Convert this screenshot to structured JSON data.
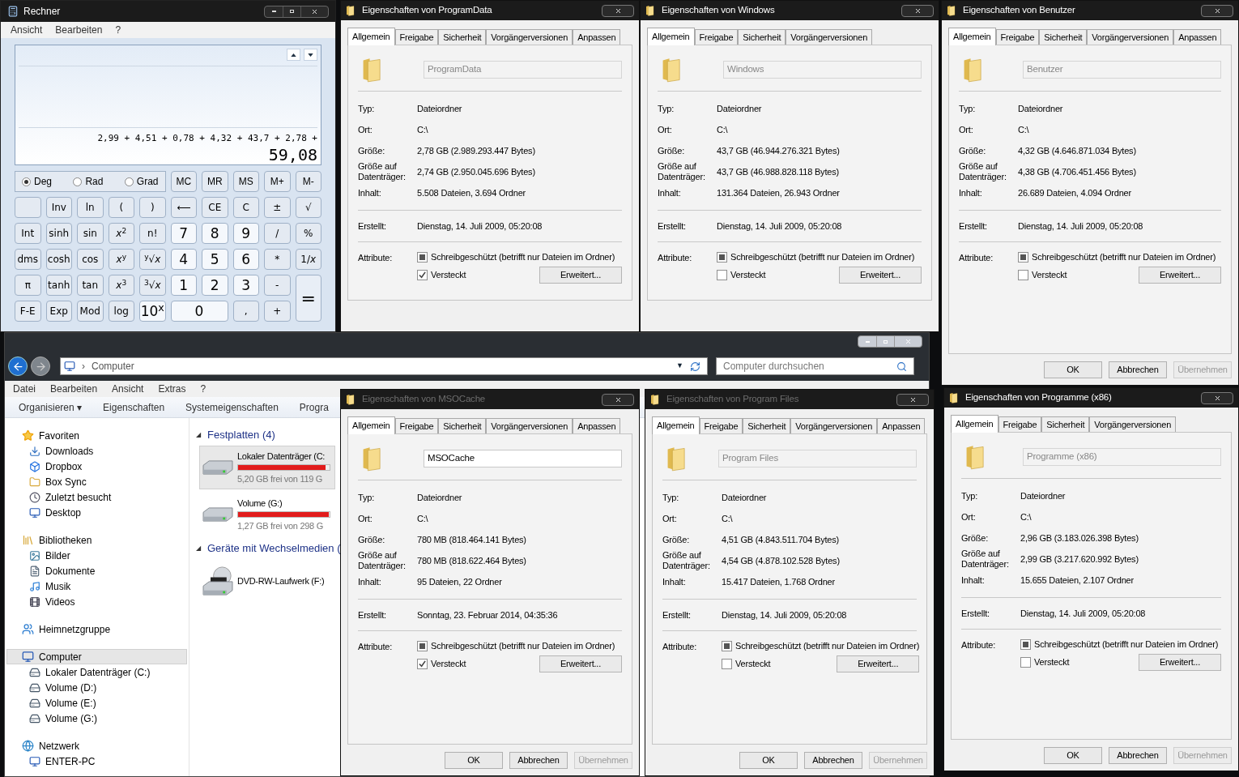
{
  "calculator": {
    "title": "Rechner",
    "menu": [
      "Ansicht",
      "Bearbeiten",
      "?"
    ],
    "expression": "2,99 + 4,51 + 0,78 + 4,32 + 43,7 + 2,78 +",
    "result": "59,08",
    "modes": [
      {
        "label": "Deg",
        "selected": true
      },
      {
        "label": "Rad",
        "selected": false
      },
      {
        "label": "Grad",
        "selected": false
      }
    ],
    "memory": [
      "MC",
      "MR",
      "MS",
      "M+",
      "M-"
    ],
    "keys": [
      {
        "kind": "blank"
      },
      {
        "kind": "func",
        "label": "Inv"
      },
      {
        "kind": "func",
        "label": "ln"
      },
      {
        "kind": "func",
        "label": "("
      },
      {
        "kind": "func",
        "label": ")"
      },
      {
        "kind": "func",
        "label": "⟵"
      },
      {
        "kind": "func",
        "label": "CE"
      },
      {
        "kind": "func",
        "label": "C"
      },
      {
        "kind": "func",
        "label": "±"
      },
      {
        "kind": "func",
        "label": "√"
      },
      {
        "kind": "func",
        "label": "Int"
      },
      {
        "kind": "func",
        "label": "sinh"
      },
      {
        "kind": "func",
        "label": "sin"
      },
      {
        "kind": "func",
        "label": "*x*$^{2}$"
      },
      {
        "kind": "func",
        "label": "n!"
      },
      {
        "kind": "digit",
        "label": "7"
      },
      {
        "kind": "digit",
        "label": "8"
      },
      {
        "kind": "digit",
        "label": "9"
      },
      {
        "kind": "func",
        "label": "/"
      },
      {
        "kind": "func",
        "label": "%"
      },
      {
        "kind": "func",
        "label": "dms"
      },
      {
        "kind": "func",
        "label": "cosh"
      },
      {
        "kind": "func",
        "label": "cos"
      },
      {
        "kind": "func",
        "label": "*x*$^{y}$"
      },
      {
        "kind": "func",
        "label": "$^{y}$√*x*"
      },
      {
        "kind": "digit",
        "label": "4"
      },
      {
        "kind": "digit",
        "label": "5"
      },
      {
        "kind": "digit",
        "label": "6"
      },
      {
        "kind": "func",
        "label": "*"
      },
      {
        "kind": "func",
        "label": "1/*x*"
      },
      {
        "kind": "func",
        "label": "π"
      },
      {
        "kind": "func",
        "label": "tanh"
      },
      {
        "kind": "func",
        "label": "tan"
      },
      {
        "kind": "func",
        "label": "*x*$^{3}$"
      },
      {
        "kind": "func",
        "label": "$^{3}$√*x*"
      },
      {
        "kind": "digit",
        "label": "1"
      },
      {
        "kind": "digit",
        "label": "2"
      },
      {
        "kind": "digit",
        "label": "3"
      },
      {
        "kind": "func",
        "label": "-"
      },
      {
        "kind": "tall",
        "label": "="
      },
      {
        "kind": "func",
        "label": "F-E"
      },
      {
        "kind": "func",
        "label": "Exp"
      },
      {
        "kind": "func",
        "label": "Mod"
      },
      {
        "kind": "func",
        "label": "log"
      },
      {
        "kind": "digit",
        "label": "10$^{x}$"
      },
      {
        "kind": "wide",
        "label": "0"
      },
      {
        "kind": "func",
        "label": ","
      },
      {
        "kind": "func",
        "label": "+"
      }
    ]
  },
  "explorer": {
    "address": {
      "separator": "›",
      "text": "Computer",
      "dropdown": "▼"
    },
    "search_placeholder": "Computer durchsuchen",
    "menu": [
      "Datei",
      "Bearbeiten",
      "Ansicht",
      "Extras",
      "?"
    ],
    "toolbar": [
      "Organisieren ▾",
      "Eigenschaften",
      "Systemeigenschaften",
      "Progra"
    ],
    "sidebar": [
      {
        "label": "Favoriten",
        "selected": false,
        "children": [
          {
            "label": "Downloads",
            "selected": false
          },
          {
            "label": "Dropbox",
            "selected": false
          },
          {
            "label": "Box Sync",
            "selected": false
          },
          {
            "label": "Zuletzt besucht",
            "selected": false
          },
          {
            "label": "Desktop",
            "selected": false
          }
        ]
      },
      {
        "label": "Bibliotheken",
        "selected": false,
        "children": [
          {
            "label": "Bilder",
            "selected": false
          },
          {
            "label": "Dokumente",
            "selected": false
          },
          {
            "label": "Musik",
            "selected": false
          },
          {
            "label": "Videos",
            "selected": false
          }
        ]
      },
      {
        "label": "Heimnetzgruppe",
        "selected": false
      },
      {
        "label": "Computer",
        "selected": true,
        "children": [
          {
            "label": "Lokaler Datenträger (C:)",
            "selected": false
          },
          {
            "label": "Volume (D:)",
            "selected": false
          },
          {
            "label": "Volume (E:)",
            "selected": false
          },
          {
            "label": "Volume (G:)",
            "selected": false
          }
        ]
      },
      {
        "label": "Netzwerk",
        "selected": false,
        "children": [
          {
            "label": "ENTER-PC",
            "selected": false
          }
        ]
      }
    ],
    "groups": [
      {
        "toggle": "◢",
        "title": "Festplatten (4)",
        "items": [
          {
            "kind": "disk",
            "name": "Lokaler Datenträger (C:",
            "free": "5,20 GB frei von 119 G",
            "level": 0.96,
            "selected": true
          },
          {
            "kind": "disk",
            "name": "Volume (G:)",
            "free": "1,27 GB frei von 298 G",
            "level": 0.99,
            "selected": false
          }
        ]
      },
      {
        "toggle": "◢",
        "title": "Geräte mit Wechselmedien (",
        "items": [
          {
            "kind": "dvd",
            "name": "DVD-RW-Laufwerk (F:)",
            "selected": false
          }
        ]
      }
    ]
  },
  "dialogs": [
    {
      "title": "Eigenschaften von ProgramData",
      "active": true,
      "tabs": [
        {
          "label": "Allgemein",
          "selected": true
        },
        {
          "label": "Freigabe",
          "selected": false
        },
        {
          "label": "Sicherheit",
          "selected": false
        },
        {
          "label": "Vorgängerversionen",
          "selected": false
        },
        {
          "label": "Anpassen",
          "selected": false
        }
      ],
      "name": {
        "value": "ProgramData",
        "disabled": true
      },
      "info": [
        {
          "label": "Typ:",
          "value": "Dateiordner"
        },
        {
          "label": "Ort:",
          "value": "C:\\"
        },
        {
          "label": "Größe:",
          "value": "2,78 GB (2.989.293.447 Bytes)"
        },
        {
          "label": "Größe auf Datenträger:",
          "value": "2,74 GB (2.950.045.696 Bytes)"
        },
        {
          "label": "Inhalt:",
          "value": "5.508 Dateien, 3.694 Ordner"
        }
      ],
      "created": {
        "label": "Erstellt:",
        "value": "Dienstag, 14. Juli 2009, 05:20:08"
      },
      "attributes": {
        "label": "Attribute:",
        "readonly": {
          "label": "Schreibgeschützt (betrifft nur Dateien im Ordner)",
          "indeterminate": true
        },
        "hidden": {
          "label": "Versteckt",
          "checked": true
        },
        "advanced": "Erweitert..."
      }
    },
    {
      "title": "Eigenschaften von Windows",
      "active": true,
      "tabs": [
        {
          "label": "Allgemein",
          "selected": true
        },
        {
          "label": "Freigabe",
          "selected": false
        },
        {
          "label": "Sicherheit",
          "selected": false
        },
        {
          "label": "Vorgängerversionen",
          "selected": false
        }
      ],
      "name": {
        "value": "Windows",
        "disabled": true
      },
      "info": [
        {
          "label": "Typ:",
          "value": "Dateiordner"
        },
        {
          "label": "Ort:",
          "value": "C:\\"
        },
        {
          "label": "Größe:",
          "value": "43,7 GB (46.944.276.321 Bytes)"
        },
        {
          "label": "Größe auf Datenträger:",
          "value": "43,7 GB (46.988.828.118 Bytes)"
        },
        {
          "label": "Inhalt:",
          "value": "131.364 Dateien, 26.943 Ordner"
        }
      ],
      "created": {
        "label": "Erstellt:",
        "value": "Dienstag, 14. Juli 2009, 05:20:08"
      },
      "attributes": {
        "label": "Attribute:",
        "readonly": {
          "label": "Schreibgeschützt (betrifft nur Dateien im Ordner)",
          "indeterminate": true
        },
        "hidden": {
          "label": "Versteckt",
          "checked": false
        },
        "advanced": "Erweitert..."
      }
    },
    {
      "title": "Eigenschaften von Benutzer",
      "active": true,
      "tabs": [
        {
          "label": "Allgemein",
          "selected": true
        },
        {
          "label": "Freigabe",
          "selected": false
        },
        {
          "label": "Sicherheit",
          "selected": false
        },
        {
          "label": "Vorgängerversionen",
          "selected": false
        },
        {
          "label": "Anpassen",
          "selected": false
        }
      ],
      "name": {
        "value": "Benutzer",
        "disabled": true
      },
      "info": [
        {
          "label": "Typ:",
          "value": "Dateiordner"
        },
        {
          "label": "Ort:",
          "value": "C:\\"
        },
        {
          "label": "Größe:",
          "value": "4,32 GB (4.646.871.034 Bytes)"
        },
        {
          "label": "Größe auf Datenträger:",
          "value": "4,38 GB (4.706.451.456 Bytes)"
        },
        {
          "label": "Inhalt:",
          "value": "26.689 Dateien, 4.094 Ordner"
        }
      ],
      "created": {
        "label": "Erstellt:",
        "value": "Dienstag, 14. Juli 2009, 05:20:08"
      },
      "attributes": {
        "label": "Attribute:",
        "readonly": {
          "label": "Schreibgeschützt (betrifft nur Dateien im Ordner)",
          "indeterminate": true
        },
        "hidden": {
          "label": "Versteckt",
          "checked": false
        },
        "advanced": "Erweitert..."
      },
      "buttons": [
        {
          "label": "OK",
          "disabled": false
        },
        {
          "label": "Abbrechen",
          "disabled": false
        },
        {
          "label": "Übernehmen",
          "disabled": true
        }
      ]
    },
    {
      "title": "Eigenschaften von MSOCache",
      "active": false,
      "tabs": [
        {
          "label": "Allgemein",
          "selected": true
        },
        {
          "label": "Freigabe",
          "selected": false
        },
        {
          "label": "Sicherheit",
          "selected": false
        },
        {
          "label": "Vorgängerversionen",
          "selected": false
        },
        {
          "label": "Anpassen",
          "selected": false
        }
      ],
      "name": {
        "value": "MSOCache",
        "disabled": false
      },
      "info": [
        {
          "label": "Typ:",
          "value": "Dateiordner"
        },
        {
          "label": "Ort:",
          "value": "C:\\"
        },
        {
          "label": "Größe:",
          "value": "780 MB (818.464.141 Bytes)"
        },
        {
          "label": "Größe auf Datenträger:",
          "value": "780 MB (818.622.464 Bytes)"
        },
        {
          "label": "Inhalt:",
          "value": "95 Dateien, 22 Ordner"
        }
      ],
      "created": {
        "label": "Erstellt:",
        "value": "Sonntag, 23. Februar 2014, 04:35:36"
      },
      "attributes": {
        "label": "Attribute:",
        "readonly": {
          "label": "Schreibgeschützt (betrifft nur Dateien im Ordner)",
          "indeterminate": true
        },
        "hidden": {
          "label": "Versteckt",
          "checked": true
        },
        "advanced": "Erweitert..."
      },
      "buttons": [
        {
          "label": "OK",
          "disabled": false
        },
        {
          "label": "Abbrechen",
          "disabled": false
        },
        {
          "label": "Übernehmen",
          "disabled": true
        }
      ]
    },
    {
      "title": "Eigenschaften von Program Files",
      "active": false,
      "tabs": [
        {
          "label": "Allgemein",
          "selected": true
        },
        {
          "label": "Freigabe",
          "selected": false
        },
        {
          "label": "Sicherheit",
          "selected": false
        },
        {
          "label": "Vorgängerversionen",
          "selected": false
        },
        {
          "label": "Anpassen",
          "selected": false
        }
      ],
      "name": {
        "value": "Program Files",
        "disabled": true
      },
      "info": [
        {
          "label": "Typ:",
          "value": "Dateiordner"
        },
        {
          "label": "Ort:",
          "value": "C:\\"
        },
        {
          "label": "Größe:",
          "value": "4,51 GB (4.843.511.704 Bytes)"
        },
        {
          "label": "Größe auf Datenträger:",
          "value": "4,54 GB (4.878.102.528 Bytes)"
        },
        {
          "label": "Inhalt:",
          "value": "15.417 Dateien, 1.768 Ordner"
        }
      ],
      "created": {
        "label": "Erstellt:",
        "value": "Dienstag, 14. Juli 2009, 05:20:08"
      },
      "attributes": {
        "label": "Attribute:",
        "readonly": {
          "label": "Schreibgeschützt (betrifft nur Dateien im Ordner)",
          "indeterminate": true
        },
        "hidden": {
          "label": "Versteckt",
          "checked": false
        },
        "advanced": "Erweitert..."
      },
      "buttons": [
        {
          "label": "OK",
          "disabled": false
        },
        {
          "label": "Abbrechen",
          "disabled": false
        },
        {
          "label": "Übernehmen",
          "disabled": true
        }
      ]
    },
    {
      "title": "Eigenschaften von Programme (x86)",
      "active": true,
      "tabs": [
        {
          "label": "Allgemein",
          "selected": true
        },
        {
          "label": "Freigabe",
          "selected": false
        },
        {
          "label": "Sicherheit",
          "selected": false
        },
        {
          "label": "Vorgängerversionen",
          "selected": false
        }
      ],
      "name": {
        "value": "Programme (x86)",
        "disabled": true
      },
      "info": [
        {
          "label": "Typ:",
          "value": "Dateiordner"
        },
        {
          "label": "Ort:",
          "value": "C:\\"
        },
        {
          "label": "Größe:",
          "value": "2,96 GB (3.183.026.398 Bytes)"
        },
        {
          "label": "Größe auf Datenträger:",
          "value": "2,99 GB (3.217.620.992 Bytes)"
        },
        {
          "label": "Inhalt:",
          "value": "15.655 Dateien, 2.107 Ordner"
        }
      ],
      "created": {
        "label": "Erstellt:",
        "value": "Dienstag, 14. Juli 2009, 05:20:08"
      },
      "attributes": {
        "label": "Attribute:",
        "readonly": {
          "label": "Schreibgeschützt (betrifft nur Dateien im Ordner)",
          "indeterminate": true
        },
        "hidden": {
          "label": "Versteckt",
          "checked": false
        },
        "advanced": "Erweitert..."
      },
      "buttons": [
        {
          "label": "OK",
          "disabled": false
        },
        {
          "label": "Abbrechen",
          "disabled": false
        },
        {
          "label": "Übernehmen",
          "disabled": true
        }
      ]
    }
  ]
}
